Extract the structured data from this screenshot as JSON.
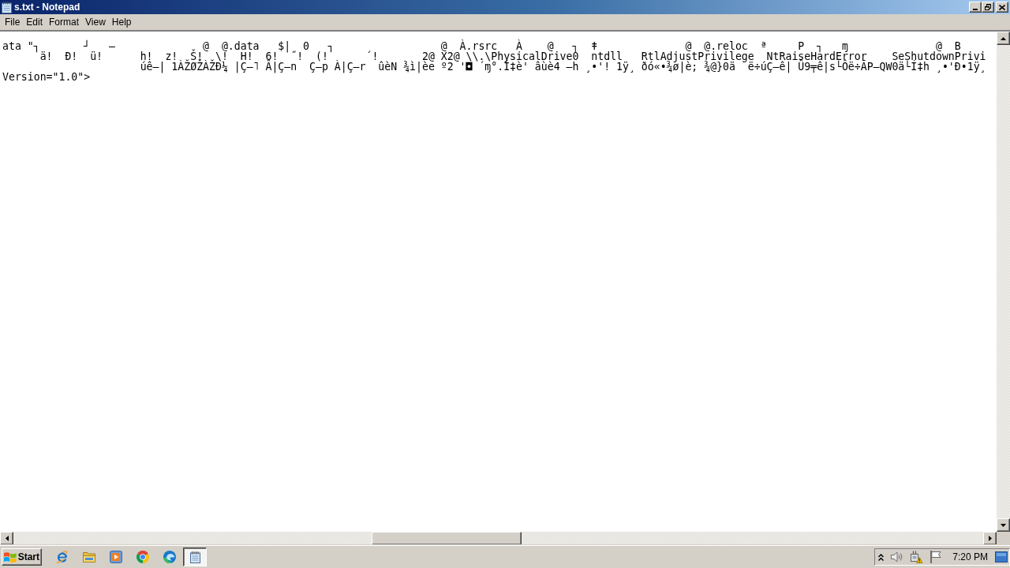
{
  "window": {
    "title": "s.txt - Notepad"
  },
  "menu": [
    "File",
    "Edit",
    "Format",
    "View",
    "Help"
  ],
  "editor": {
    "lines": [
      "ata \"┐       ┘   –              @  @.data   $|  0   ┐                 @  À.rsrc   À    @   ┐  ǂ              @  @.reloc  ª     P  ┐   ɱ              @  B",
      "      ä!  Đ!  ü!      h!  z!  Š!  \\!  H!  6!  ˝!  (!      ´!       2@ X2@ \\\\.\\PhysicalDrive0  ntdll   RtlAdjustPrivilege  NtRaiseHardError    SeShutdownPrivi",
      "                      úê–| 1ÀŽØŽÀŽĐ¼ |Ç–˥ Â|Ç–n  Ç–p À|Ç–r  ûèN ¾ì|èe º2 '◘ ´ɱ°.Í‡è' âùè4 –h ¸•'! 1ÿ¸ ðó«•¾ø|è; ¾@}0ä  ë÷úÇ–ê| Û9╤ê|s└Ôë÷ÃP–QW0ä└Í‡h ¸•'Đ•1ÿ¸",
      "Version=\"1.0\">"
    ]
  },
  "taskbar": {
    "start": "Start",
    "tasks": [
      {
        "selected": true
      }
    ],
    "clock": "7:20 PM"
  }
}
